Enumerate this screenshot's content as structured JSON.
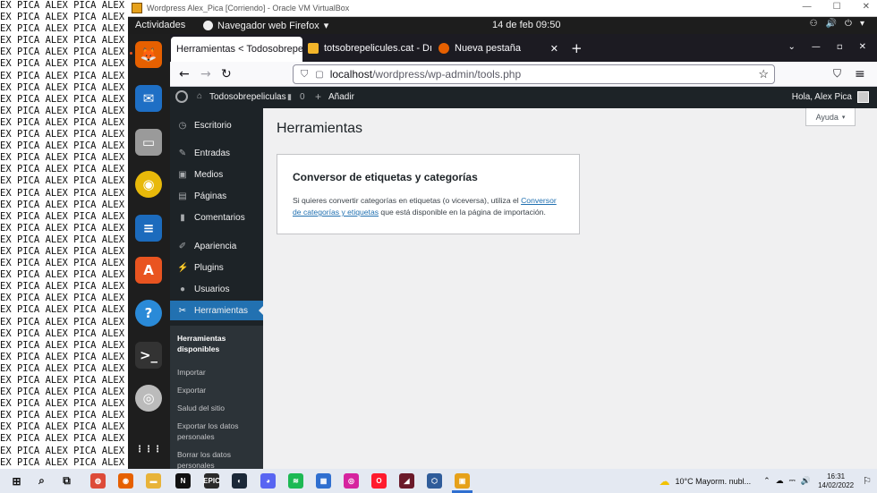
{
  "background_text": "EX PICA ALEX PICA ALEX PI",
  "vbox": {
    "title": "Wordpress Alex_Pica [Corriendo] - Oracle VM VirtualBox",
    "controls": [
      "—",
      "☐",
      "✕"
    ]
  },
  "gnome": {
    "activities": "Actividades",
    "app_menu": "Navegador web Firefox",
    "app_menu_arrow": "▾",
    "clock": "14 de feb  09:50",
    "tray": [
      "⚇",
      "🔊",
      "⏻",
      "▾"
    ]
  },
  "dock": [
    {
      "icon": "firefox-icon",
      "glyph": "🦊",
      "color": "#e66000"
    },
    {
      "icon": "thunderbird-icon",
      "glyph": "✉",
      "color": "#1e6fc5"
    },
    {
      "icon": "files-icon",
      "glyph": "▭",
      "color": "#9a9a9a"
    },
    {
      "icon": "rhythmbox-icon",
      "glyph": "◉",
      "color": "#e8b90a"
    },
    {
      "icon": "writer-icon",
      "glyph": "≡",
      "color": "#1c6bbd"
    },
    {
      "icon": "software-icon",
      "glyph": "A",
      "color": "#e95420"
    },
    {
      "icon": "help-icon",
      "glyph": "?",
      "color": "#2a8ad8"
    },
    {
      "icon": "terminal-icon",
      "glyph": ">_",
      "color": "#333333"
    },
    {
      "icon": "dvd-icon",
      "glyph": "◎",
      "color": "#bbbbbb"
    },
    {
      "icon": "app-grid-icon",
      "glyph": "⋮⋮⋮",
      "color": "#1e1e1e"
    }
  ],
  "tabs": [
    {
      "label": "Herramientas < Todosobrepeli",
      "close": "✕",
      "active": true
    },
    {
      "label": "totsobrepelicules.cat - Dı",
      "close": "✕",
      "active": false
    },
    {
      "label": "Nueva pestaña",
      "close": "✕",
      "active": false
    }
  ],
  "new_tab": "+",
  "window_controls": [
    "⌄",
    "—",
    "▫",
    "✕"
  ],
  "nav": {
    "back": "←",
    "forward": "→",
    "reload": "↻"
  },
  "url": {
    "host": "localhost",
    "path": "/wordpress/wp-admin/tools.php"
  },
  "nav_right": {
    "bookmark": "☆",
    "pocket": "⛉",
    "menu": "≡"
  },
  "wp": {
    "adminbar": {
      "site": "Todosobrepeliculas",
      "comments_count": "0",
      "add_new": "Añadir",
      "greeting": "Hola, Alex Pica"
    },
    "menu": [
      {
        "label": "Escritorio",
        "glyph": "◷"
      },
      {
        "label": "Entradas",
        "glyph": "✎"
      },
      {
        "label": "Medios",
        "glyph": "▣"
      },
      {
        "label": "Páginas",
        "glyph": "▤"
      },
      {
        "label": "Comentarios",
        "glyph": "▮"
      },
      {
        "label": "Apariencia",
        "glyph": "✐"
      },
      {
        "label": "Plugins",
        "glyph": "⚡"
      },
      {
        "label": "Usuarios",
        "glyph": "●"
      },
      {
        "label": "Herramientas",
        "glyph": "✂"
      }
    ],
    "submenu": [
      "Herramientas disponibles",
      "Importar",
      "Exportar",
      "Salud del sitio",
      "Exportar los datos personales",
      "Borrar los datos personales"
    ],
    "page_title": "Herramientas",
    "help": "Ayuda",
    "card": {
      "title": "Conversor de etiquetas y categorías",
      "text_before": "Si quieres convertir categorías en etiquetas (o viceversa), utiliza el ",
      "link": "Conversor de categorías y etiquetas",
      "text_after": " que está disponible en la página de importación."
    }
  },
  "taskbar": {
    "weather": "10°C  Mayorm. nubl...",
    "time": "16:31",
    "date": "14/02/2022",
    "apps": [
      {
        "icon": "windows-start-icon",
        "color": "#1a1a1a",
        "glyph": "⊞"
      },
      {
        "icon": "search-icon",
        "color": "#1a1a1a",
        "glyph": "⌕"
      },
      {
        "icon": "task-view-icon",
        "color": "#1a1a1a",
        "glyph": "⧉"
      },
      {
        "icon": "chrome-icon",
        "color": "#dd4b39",
        "glyph": "◍"
      },
      {
        "icon": "firefox-taskbar-icon",
        "color": "#e66000",
        "glyph": "◉"
      },
      {
        "icon": "explorer-icon",
        "color": "#e8b339",
        "glyph": "▬"
      },
      {
        "icon": "netflix-icon",
        "color": "#111111",
        "glyph": "N"
      },
      {
        "icon": "epic-icon",
        "color": "#2a2a2a",
        "glyph": "EPIC"
      },
      {
        "icon": "steam-icon",
        "color": "#1b2838",
        "glyph": "◐"
      },
      {
        "icon": "discord-icon",
        "color": "#5865f2",
        "glyph": "◕"
      },
      {
        "icon": "spotify-icon",
        "color": "#1db954",
        "glyph": "≋"
      },
      {
        "icon": "game-icon",
        "color": "#2f6fd0",
        "glyph": "▦"
      },
      {
        "icon": "instagram-icon",
        "color": "#d6249f",
        "glyph": "◎"
      },
      {
        "icon": "opera-icon",
        "color": "#ff1b2d",
        "glyph": "O"
      },
      {
        "icon": "media-icon",
        "color": "#6b1a2a",
        "glyph": "◢"
      },
      {
        "icon": "virtualbox-taskbar-icon",
        "color": "#2f5c9a",
        "glyph": "⬡"
      },
      {
        "icon": "vm-window-icon",
        "color": "#e6a11a",
        "glyph": "▣"
      }
    ],
    "tray": [
      "⌃",
      "☁",
      "⎓",
      "🔊",
      "⚐"
    ]
  }
}
